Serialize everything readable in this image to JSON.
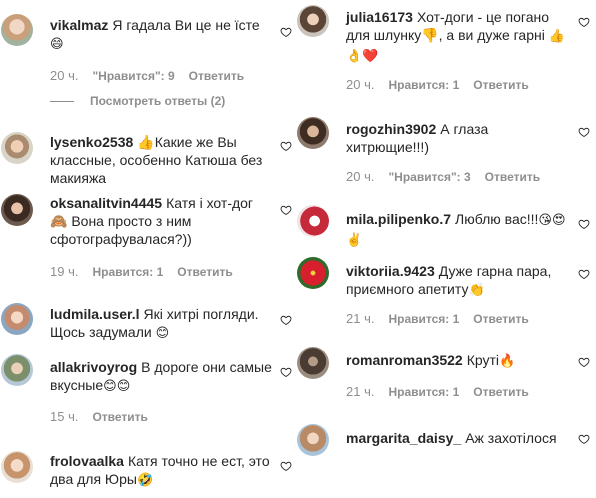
{
  "left": [
    {
      "user": "vikalmaz",
      "text": "Я гадала Ви це не їсте ",
      "emoji": "😄",
      "time": "20 ч.",
      "likes": "\"Нравится\": 9",
      "reply": "Ответить",
      "view_replies": "Посмотреть ответы (2)"
    },
    {
      "user": "lysenko2538",
      "text": "👍Какие же Вы классные, особенно Катюша без макияжа",
      "emoji": ""
    },
    {
      "user": "oksanalitvin4445",
      "text": "Катя і хот-дог 🙈 Вона просто з ним сфотографувалася?))",
      "emoji": "",
      "time": "19 ч.",
      "likes": "Нравится: 1",
      "reply": "Ответить"
    },
    {
      "user": "ludmila.user.l",
      "text": "Які хитрі погляди. Щось задумали ",
      "emoji": "😊"
    },
    {
      "user": "allakrivoyrog",
      "text": "В дороге они самые вкусные",
      "emoji": "😊😊",
      "time": "15 ч.",
      "reply": "Ответить"
    },
    {
      "user": "frolovaalka",
      "text": "Катя точно не ест, это два для Юры",
      "emoji": "🤣"
    }
  ],
  "right": [
    {
      "user": "julia16173",
      "text": "Хот-доги - це погано для шлунку👎, а ви дуже гарні ",
      "emoji": "👍👌❤️",
      "time": "20 ч.",
      "likes": "Нравится: 1",
      "reply": "Ответить"
    },
    {
      "user": "rogozhin3902",
      "text": "А глаза хитрющие!!!)",
      "emoji": "",
      "time": "20 ч.",
      "likes": "\"Нравится\": 3",
      "reply": "Ответить"
    },
    {
      "user": "mila.pilipenko.7",
      "text": "Люблю вас!!!",
      "emoji": "😘😍✌️"
    },
    {
      "user": "viktoriia.9423",
      "text": "Дуже гарна пара, приємного апетиту",
      "emoji": "👏",
      "time": "21 ч.",
      "likes": "Нравится: 1",
      "reply": "Ответить"
    },
    {
      "user": "romanroman3522",
      "text": "Круті",
      "emoji": "🔥",
      "time": "21 ч.",
      "likes": "Нравится: 1",
      "reply": "Ответить"
    },
    {
      "user": "margarita_daisy_",
      "text": "Аж захотілося",
      "emoji": ""
    }
  ]
}
